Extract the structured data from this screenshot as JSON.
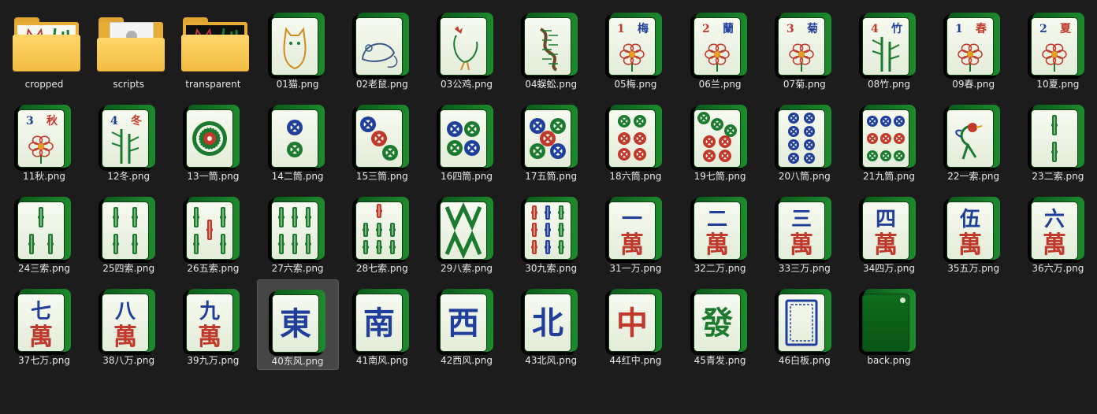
{
  "files": [
    {
      "label": "cropped",
      "kind": "folder",
      "content": "tiles"
    },
    {
      "label": "scripts",
      "kind": "folder",
      "content": "paper"
    },
    {
      "label": "transparent",
      "kind": "folder",
      "content": "tiles-dark"
    },
    {
      "label": "01猫.png",
      "kind": "tile",
      "art": "cat"
    },
    {
      "label": "02老鼠.png",
      "kind": "tile",
      "art": "rat"
    },
    {
      "label": "03公鸡.png",
      "kind": "tile",
      "art": "rooster"
    },
    {
      "label": "04蜈蚣.png",
      "kind": "tile",
      "art": "centipede"
    },
    {
      "label": "05梅.png",
      "kind": "tile",
      "art": "flower",
      "num": "1",
      "char": "梅",
      "numColor": "#c0392b",
      "charColor": "#1f3f9a"
    },
    {
      "label": "06兰.png",
      "kind": "tile",
      "art": "flower",
      "num": "2",
      "char": "蘭",
      "numColor": "#c0392b",
      "charColor": "#1f3f9a"
    },
    {
      "label": "07菊.png",
      "kind": "tile",
      "art": "flower",
      "num": "3",
      "char": "菊",
      "numColor": "#c0392b",
      "charColor": "#1f3f9a"
    },
    {
      "label": "08竹.png",
      "kind": "tile",
      "art": "bamboo-plant",
      "num": "4",
      "char": "竹",
      "numColor": "#c0392b",
      "charColor": "#1f3f9a"
    },
    {
      "label": "09春.png",
      "kind": "tile",
      "art": "flower",
      "num": "1",
      "char": "春",
      "numColor": "#1f3f9a",
      "charColor": "#c0392b"
    },
    {
      "label": "10夏.png",
      "kind": "tile",
      "art": "flower",
      "num": "2",
      "char": "夏",
      "numColor": "#1f3f9a",
      "charColor": "#c0392b"
    },
    {
      "label": "11秋.png",
      "kind": "tile",
      "art": "flower",
      "num": "3",
      "char": "秋",
      "numColor": "#1f3f9a",
      "charColor": "#c0392b"
    },
    {
      "label": "12冬.png",
      "kind": "tile",
      "art": "bamboo-plant",
      "num": "4",
      "char": "冬",
      "numColor": "#1f3f9a",
      "charColor": "#c0392b"
    },
    {
      "label": "13一筒.png",
      "kind": "tile",
      "art": "circles",
      "count": 1
    },
    {
      "label": "14二筒.png",
      "kind": "tile",
      "art": "circles",
      "count": 2
    },
    {
      "label": "15三筒.png",
      "kind": "tile",
      "art": "circles",
      "count": 3
    },
    {
      "label": "16四筒.png",
      "kind": "tile",
      "art": "circles",
      "count": 4
    },
    {
      "label": "17五筒.png",
      "kind": "tile",
      "art": "circles",
      "count": 5
    },
    {
      "label": "18六筒.png",
      "kind": "tile",
      "art": "circles",
      "count": 6
    },
    {
      "label": "19七筒.png",
      "kind": "tile",
      "art": "circles",
      "count": 7
    },
    {
      "label": "20八筒.png",
      "kind": "tile",
      "art": "circles",
      "count": 8
    },
    {
      "label": "21九筒.png",
      "kind": "tile",
      "art": "circles",
      "count": 9
    },
    {
      "label": "22一索.png",
      "kind": "tile",
      "art": "bird"
    },
    {
      "label": "23二索.png",
      "kind": "tile",
      "art": "bamboo",
      "count": 2
    },
    {
      "label": "24三索.png",
      "kind": "tile",
      "art": "bamboo",
      "count": 3
    },
    {
      "label": "25四索.png",
      "kind": "tile",
      "art": "bamboo",
      "count": 4
    },
    {
      "label": "26五索.png",
      "kind": "tile",
      "art": "bamboo",
      "count": 5
    },
    {
      "label": "27六索.png",
      "kind": "tile",
      "art": "bamboo",
      "count": 6
    },
    {
      "label": "28七索.png",
      "kind": "tile",
      "art": "bamboo",
      "count": 7
    },
    {
      "label": "29八索.png",
      "kind": "tile",
      "art": "bamboo",
      "count": 8
    },
    {
      "label": "30九索.png",
      "kind": "tile",
      "art": "bamboo",
      "count": 9
    },
    {
      "label": "31一万.png",
      "kind": "tile",
      "art": "character",
      "top": "一"
    },
    {
      "label": "32二万.png",
      "kind": "tile",
      "art": "character",
      "top": "二"
    },
    {
      "label": "33三万.png",
      "kind": "tile",
      "art": "character",
      "top": "三"
    },
    {
      "label": "34四万.png",
      "kind": "tile",
      "art": "character",
      "top": "四"
    },
    {
      "label": "35五万.png",
      "kind": "tile",
      "art": "character",
      "top": "伍"
    },
    {
      "label": "36六万.png",
      "kind": "tile",
      "art": "character",
      "top": "六"
    },
    {
      "label": "37七万.png",
      "kind": "tile",
      "art": "character",
      "top": "七"
    },
    {
      "label": "38八万.png",
      "kind": "tile",
      "art": "character",
      "top": "八"
    },
    {
      "label": "39九万.png",
      "kind": "tile",
      "art": "character",
      "top": "九"
    },
    {
      "label": "40东风.png",
      "kind": "tile",
      "art": "honor",
      "char": "東",
      "color": "#1f3f9a",
      "selected": true
    },
    {
      "label": "41南风.png",
      "kind": "tile",
      "art": "honor",
      "char": "南",
      "color": "#1f3f9a"
    },
    {
      "label": "42西风.png",
      "kind": "tile",
      "art": "honor",
      "char": "西",
      "color": "#1f3f9a"
    },
    {
      "label": "43北风.png",
      "kind": "tile",
      "art": "honor",
      "char": "北",
      "color": "#1f3f9a"
    },
    {
      "label": "44红中.png",
      "kind": "tile",
      "art": "honor",
      "char": "中",
      "color": "#c0392b"
    },
    {
      "label": "45青发.png",
      "kind": "tile",
      "art": "honor",
      "char": "發",
      "color": "#1b7a2e"
    },
    {
      "label": "46白板.png",
      "kind": "tile",
      "art": "white"
    },
    {
      "label": "back.png",
      "kind": "tile",
      "art": "back"
    }
  ],
  "wan_char": "萬",
  "colors": {
    "background": "#1c1c1c",
    "label": "#e6e6e6",
    "red": "#c0392b",
    "blue": "#1f3f9a",
    "green": "#1b7a2e"
  }
}
